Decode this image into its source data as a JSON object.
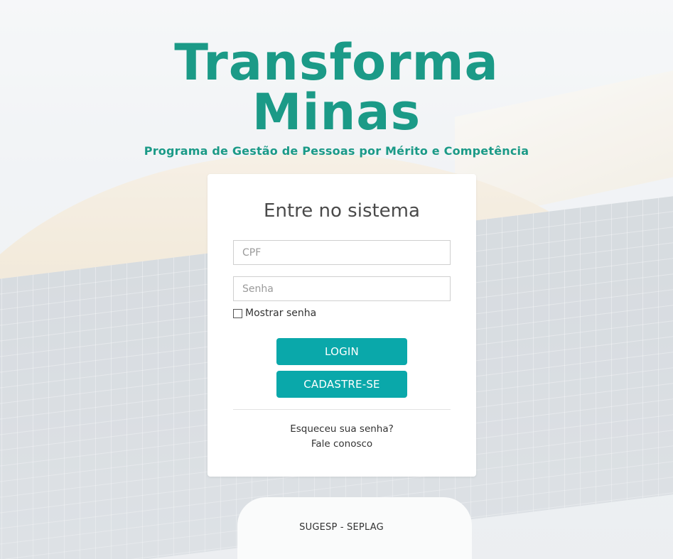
{
  "header": {
    "title_line1": "Transforma",
    "title_line2": "Minas",
    "tagline": "Programa de Gestão de Pessoas por Mérito e Competência"
  },
  "login": {
    "title": "Entre no sistema",
    "cpf": {
      "placeholder": "CPF",
      "value": ""
    },
    "senha": {
      "placeholder": "Senha",
      "value": ""
    },
    "show_password_label": "Mostrar senha",
    "show_password_checked": false,
    "login_button": "LOGIN",
    "register_button": "CADASTRE-SE",
    "forgot_link": "Esqueceu sua senha?",
    "contact_link": "Fale conosco"
  },
  "footer": {
    "text": "SUGESP - SEPLAG"
  },
  "colors": {
    "brand": "#1b9a87",
    "button": "#0aa8aa"
  }
}
